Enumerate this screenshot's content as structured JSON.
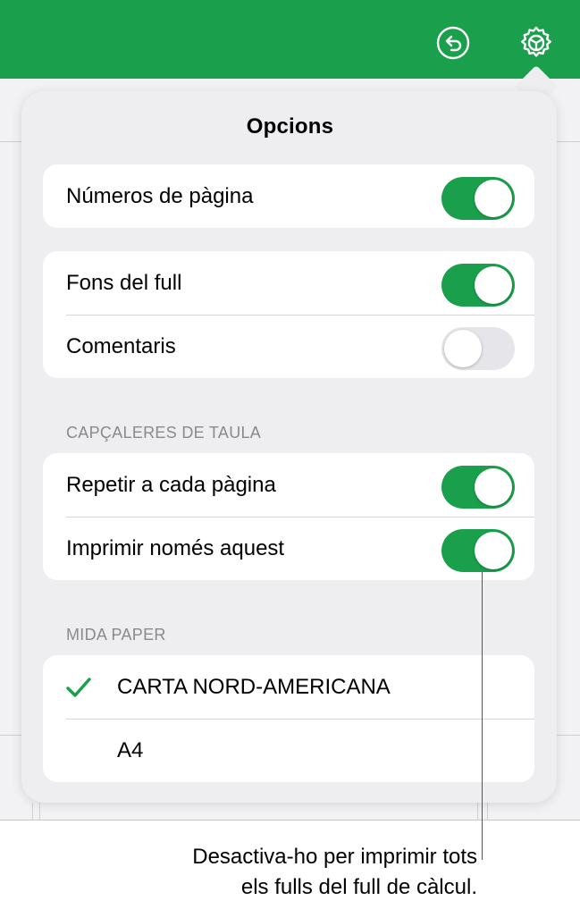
{
  "toolbar": {
    "icons": [
      "undo-icon",
      "settings-icon"
    ],
    "color": "#1aa04c"
  },
  "popover": {
    "title": "Opcions",
    "page_numbers": {
      "label": "Números de pàgina",
      "on": true
    },
    "sheet_background": {
      "label": "Fons del full",
      "on": true
    },
    "comments": {
      "label": "Comentaris",
      "on": false
    },
    "table_headers": {
      "header": "CAPÇALERES DE TAULA",
      "repeat_each_page": {
        "label": "Repetir a cada pàgina",
        "on": true
      },
      "print_only_this": {
        "label": "Imprimir només aquest",
        "on": true
      }
    },
    "paper_size": {
      "header": "MIDA PAPER",
      "options": [
        {
          "label": "CARTA NORD-AMERICANA",
          "selected": true
        },
        {
          "label": "A4",
          "selected": false
        }
      ]
    }
  },
  "callout": {
    "line1": "Desactiva-ho per imprimir tots",
    "line2": "els fulls del full de càlcul."
  },
  "colors": {
    "accent": "#1aa04c",
    "toggle_off": "#e6e6ea",
    "section_header": "#8a8a8e"
  }
}
